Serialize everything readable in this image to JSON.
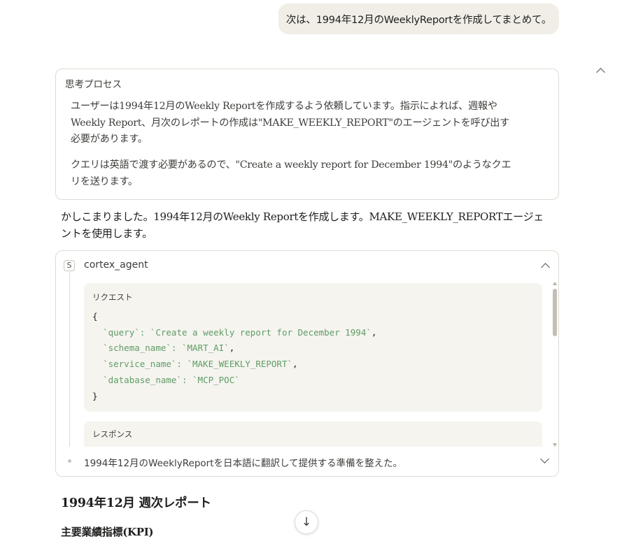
{
  "user_message": "次は、1994年12月のWeeklyReportを作成してまとめて。",
  "thinking": {
    "title": "思考プロセス",
    "paragraph1": "ユーザーは1994年12月のWeekly Reportを作成するよう依頼しています。指示によれば、週報やWeekly Report、月次のレポートの作成は\"MAKE_WEEKLY_REPORT\"のエージェントを呼び出す必要があります。",
    "paragraph2": "クエリは英語で渡す必要があるので、\"Create a weekly report for December 1994\"のようなクエリを送ります。"
  },
  "reply": "かしこまりました。1994年12月のWeekly Reportを作成します。MAKE_WEEKLY_REPORTエージェントを使用します。",
  "tool": {
    "badge": "S",
    "name": "cortex_agent",
    "request_label": "リクエスト",
    "open_brace": "{",
    "close_brace": "}",
    "params": [
      {
        "key": "`query`",
        "value": "`Create a weekly report for December 1994`"
      },
      {
        "key": "`schema_name`",
        "value": "`MART_AI`"
      },
      {
        "key": "`service_name`",
        "value": "`MAKE_WEEKLY_REPORT`"
      },
      {
        "key": "`database_name`",
        "value": "`MCP_POC`"
      }
    ],
    "response_label": "レスポンス",
    "footer_summary": "1994年12月のWeeklyReportを日本語に翻訳して提供する準備を整えた。"
  },
  "report": {
    "title": "1994年12月 週次レポート",
    "section_heading": "主要業績指標(KPI)"
  },
  "scroll_down_icon": "↓",
  "icons": [
    "chevron-up-icon",
    "chevron-down-icon",
    "arrow-down-icon"
  ],
  "colors": {
    "accent_code": "#5f9c66",
    "bubble_bg": "#f0eee6",
    "code_bg": "#f5f4ef",
    "border": "#dedbd2"
  }
}
